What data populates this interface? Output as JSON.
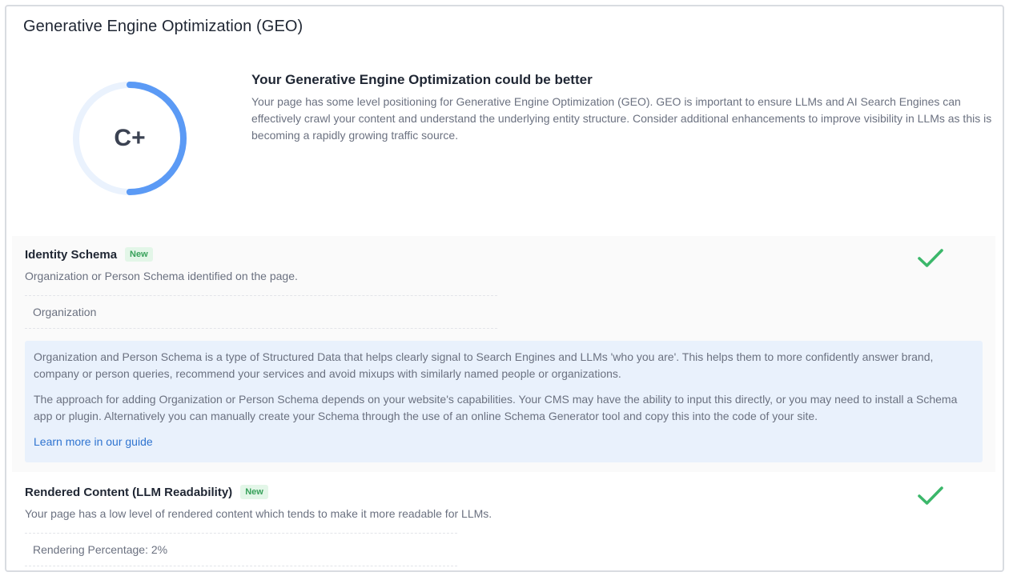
{
  "page": {
    "title": "Generative Engine Optimization (GEO)"
  },
  "score": {
    "grade": "C+",
    "fraction": 0.5,
    "color_fill": "#5b9af5",
    "color_track": "#eaf2fd"
  },
  "summary": {
    "heading": "Your Generative Engine Optimization could be better",
    "text": "Your page has some level positioning for Generative Engine Optimization (GEO). GEO is important to ensure LLMs and AI Search Engines can effectively crawl your content and understand the underlying entity structure. Consider additional enhancements to improve visibility in LLMs as this is becoming a rapidly growing traffic source."
  },
  "sections": {
    "identity": {
      "title": "Identity Schema",
      "badge": "New",
      "description": "Organization or Person Schema identified on the page.",
      "status_icon": "check-icon",
      "result": "Organization",
      "info_paragraph_1": "Organization and Person Schema is a type of Structured Data that helps clearly signal to Search Engines and LLMs 'who you are'. This helps them to more confidently answer brand, company or person queries, recommend your services and avoid mixups with similarly named people or organizations.",
      "info_paragraph_2": "The approach for adding Organization or Person Schema depends on your website's capabilities. Your CMS may have the ability to input this directly, or you may need to install a Schema app or plugin. Alternatively you can manually create your Schema through the use of an online Schema Generator tool and copy this into the code of your site.",
      "link_label": "Learn more in our guide"
    },
    "rendered": {
      "title": "Rendered Content (LLM Readability)",
      "badge": "New",
      "description": "Your page has a low level of rendered content which tends to make it more readable for LLMs.",
      "status_icon": "check-icon",
      "result": "Rendering Percentage: 2%"
    }
  },
  "colors": {
    "check": "#3bb76a",
    "link": "#2f74d0",
    "badge_text": "#37a15a",
    "badge_bg": "#e3f6e8",
    "info_bg": "#e9f1fc"
  }
}
